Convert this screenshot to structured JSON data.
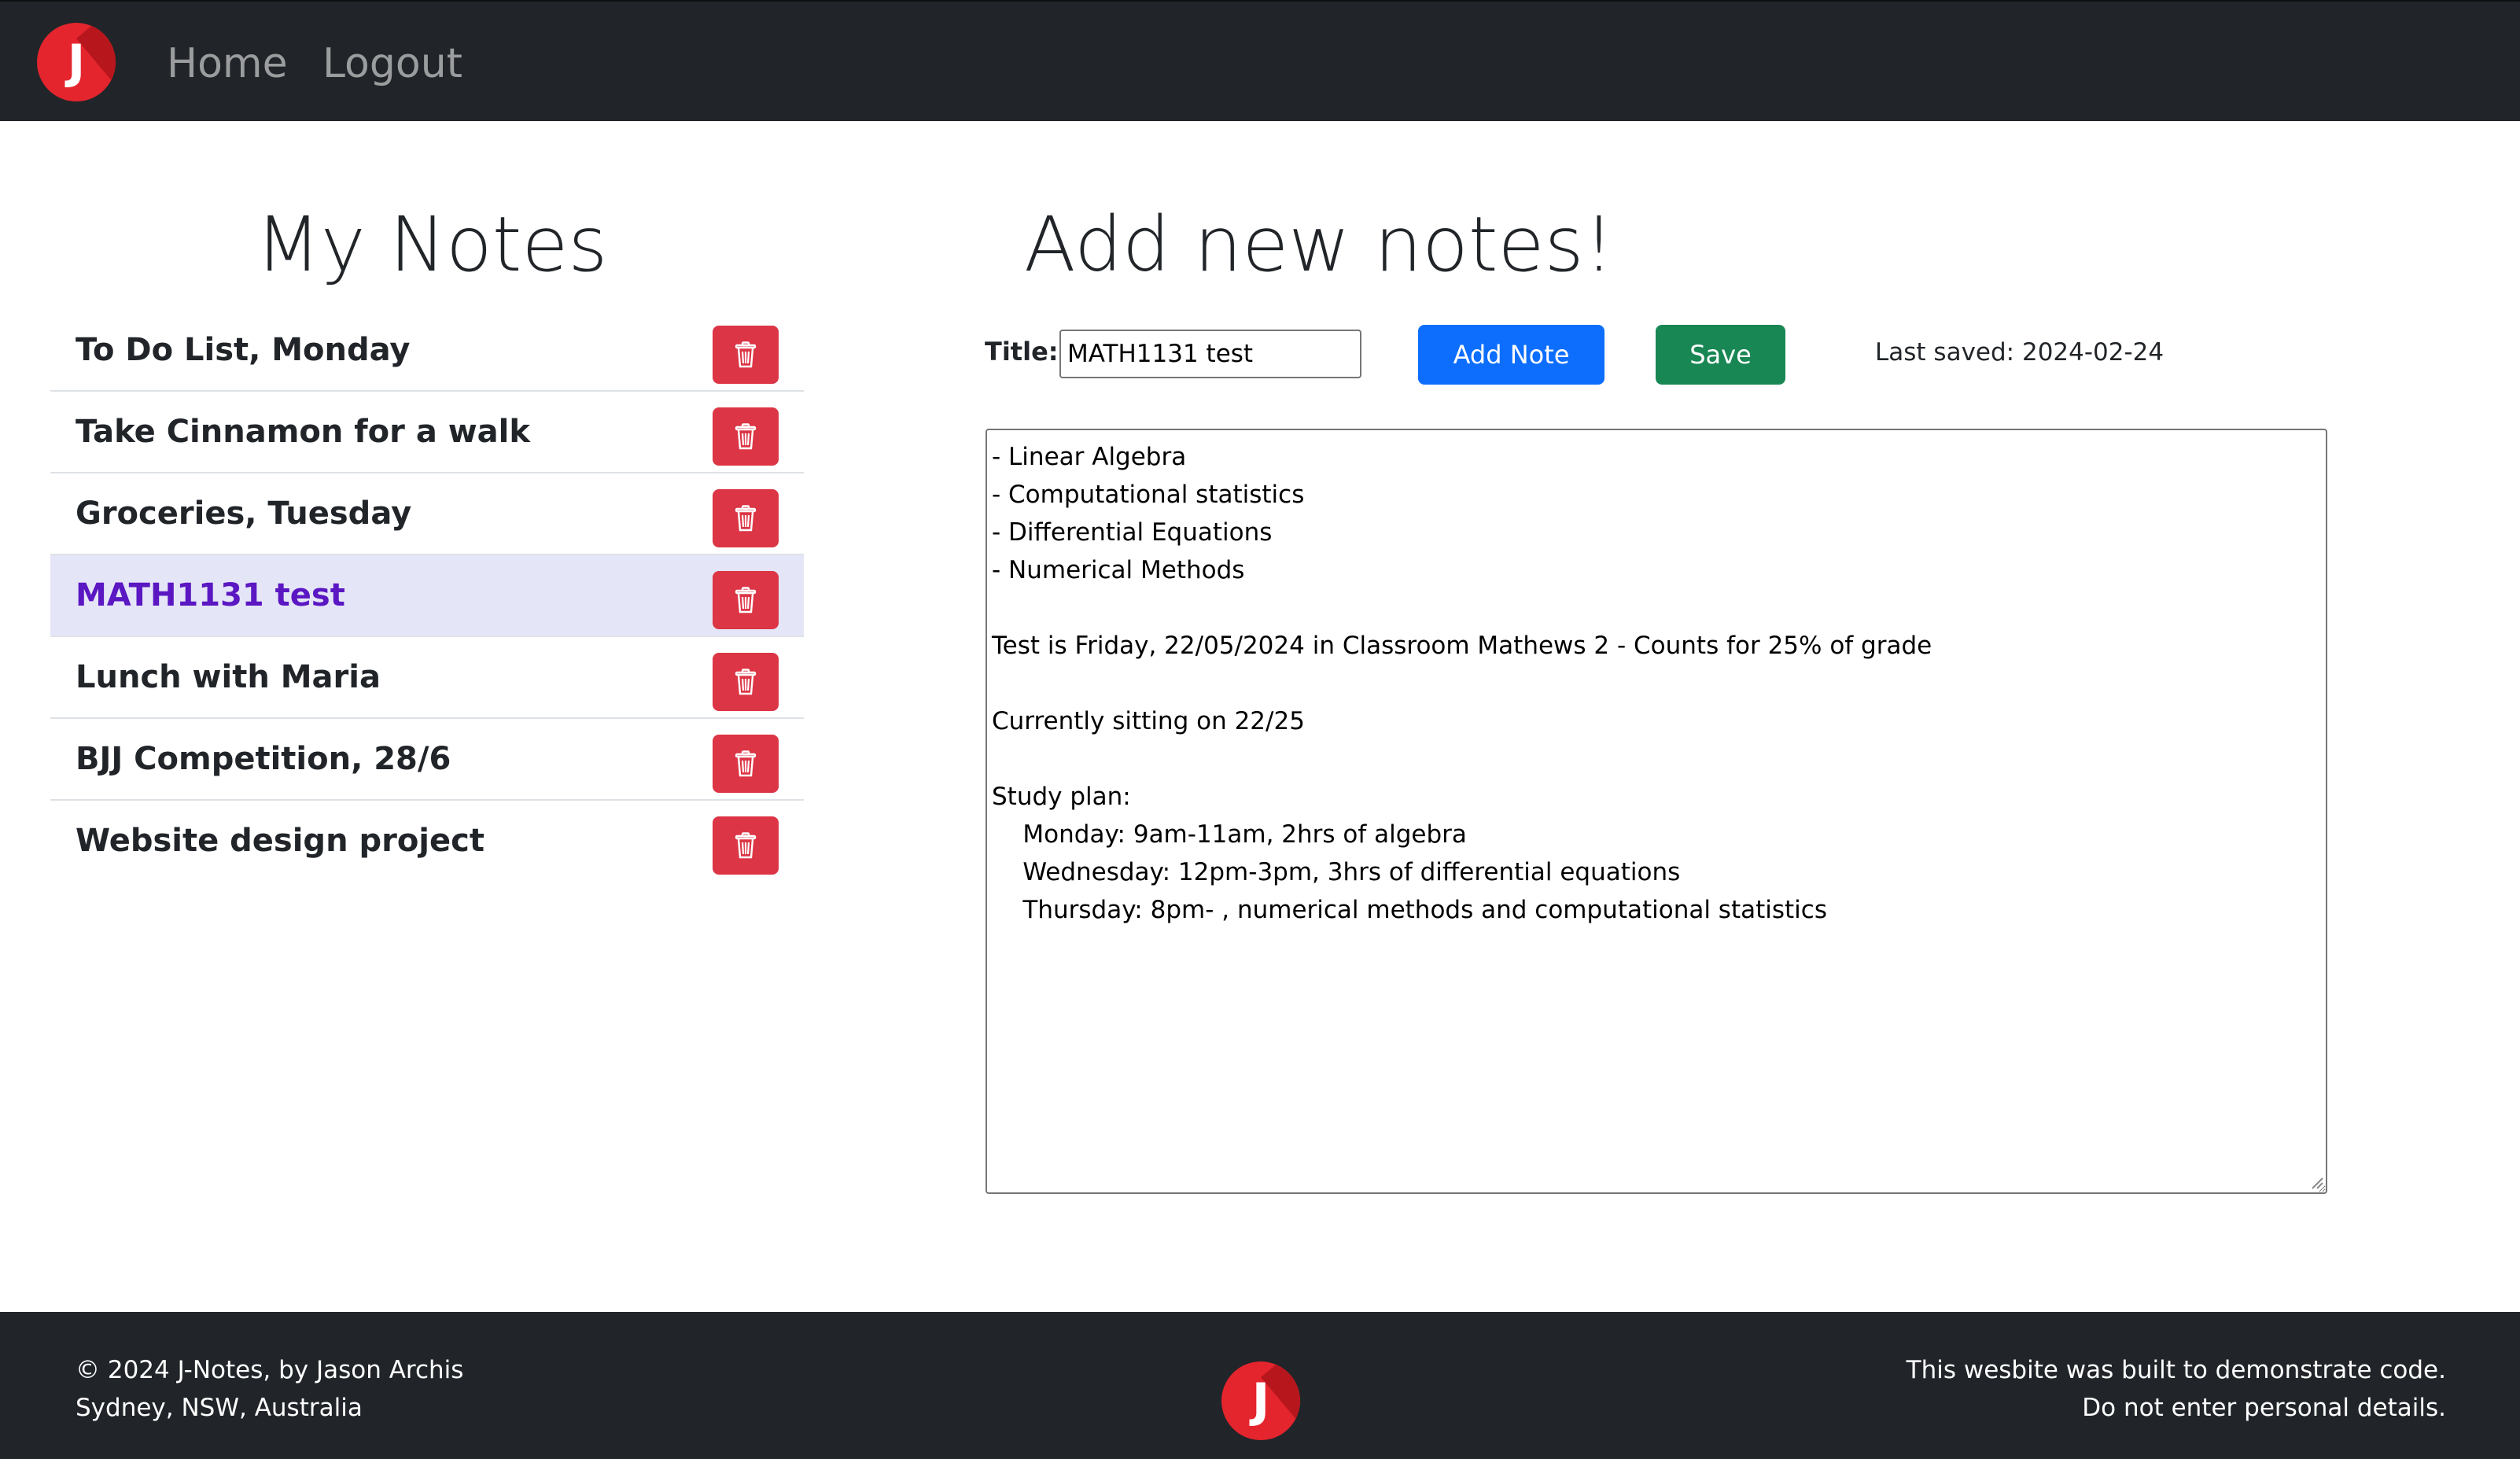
{
  "app": {
    "logo_letter": "J"
  },
  "navbar": {
    "links": [
      {
        "label": "Home"
      },
      {
        "label": "Logout"
      }
    ]
  },
  "notes_panel": {
    "title": "My Notes",
    "items": [
      {
        "label": "To Do List, Monday",
        "active": false
      },
      {
        "label": "Take Cinnamon for a walk",
        "active": false
      },
      {
        "label": "Groceries, Tuesday",
        "active": false
      },
      {
        "label": "MATH1131 test",
        "active": true
      },
      {
        "label": "Lunch with Maria",
        "active": false
      },
      {
        "label": "BJJ Competition, 28/6",
        "active": false
      },
      {
        "label": "Website design project",
        "active": false
      }
    ],
    "delete_icon": "trash-icon"
  },
  "editor": {
    "title": "Add new notes!",
    "title_label": "Title:",
    "title_value": "MATH1131 test",
    "add_button": "Add Note",
    "save_button": "Save",
    "last_saved": "Last saved: 2024-02-24",
    "body": "- Linear Algebra\n- Computational statistics\n- Differential Equations\n- Numerical Methods\n\nTest is Friday, 22/05/2024 in Classroom Mathews 2 - Counts for 25% of grade\n\nCurrently sitting on 22/25\n\nStudy plan:\n    Monday: 9am-11am, 2hrs of algebra\n    Wednesday: 12pm-3pm, 3hrs of differential equations\n    Thursday: 8pm- , numerical methods and computational statistics"
  },
  "footer": {
    "left_line1": "© 2024 J-Notes, by Jason Archis",
    "left_line2": "Sydney, NSW, Australia",
    "right_line1": "This wesbite was built to demonstrate code.",
    "right_line2": "Do not enter personal details."
  },
  "colors": {
    "navbar_bg": "#212529",
    "danger": "#dc3545",
    "primary": "#0d6efd",
    "success": "#198754",
    "active_bg": "#e5e5f8",
    "active_text": "#5a17c2",
    "logo_red": "#e4252d"
  }
}
